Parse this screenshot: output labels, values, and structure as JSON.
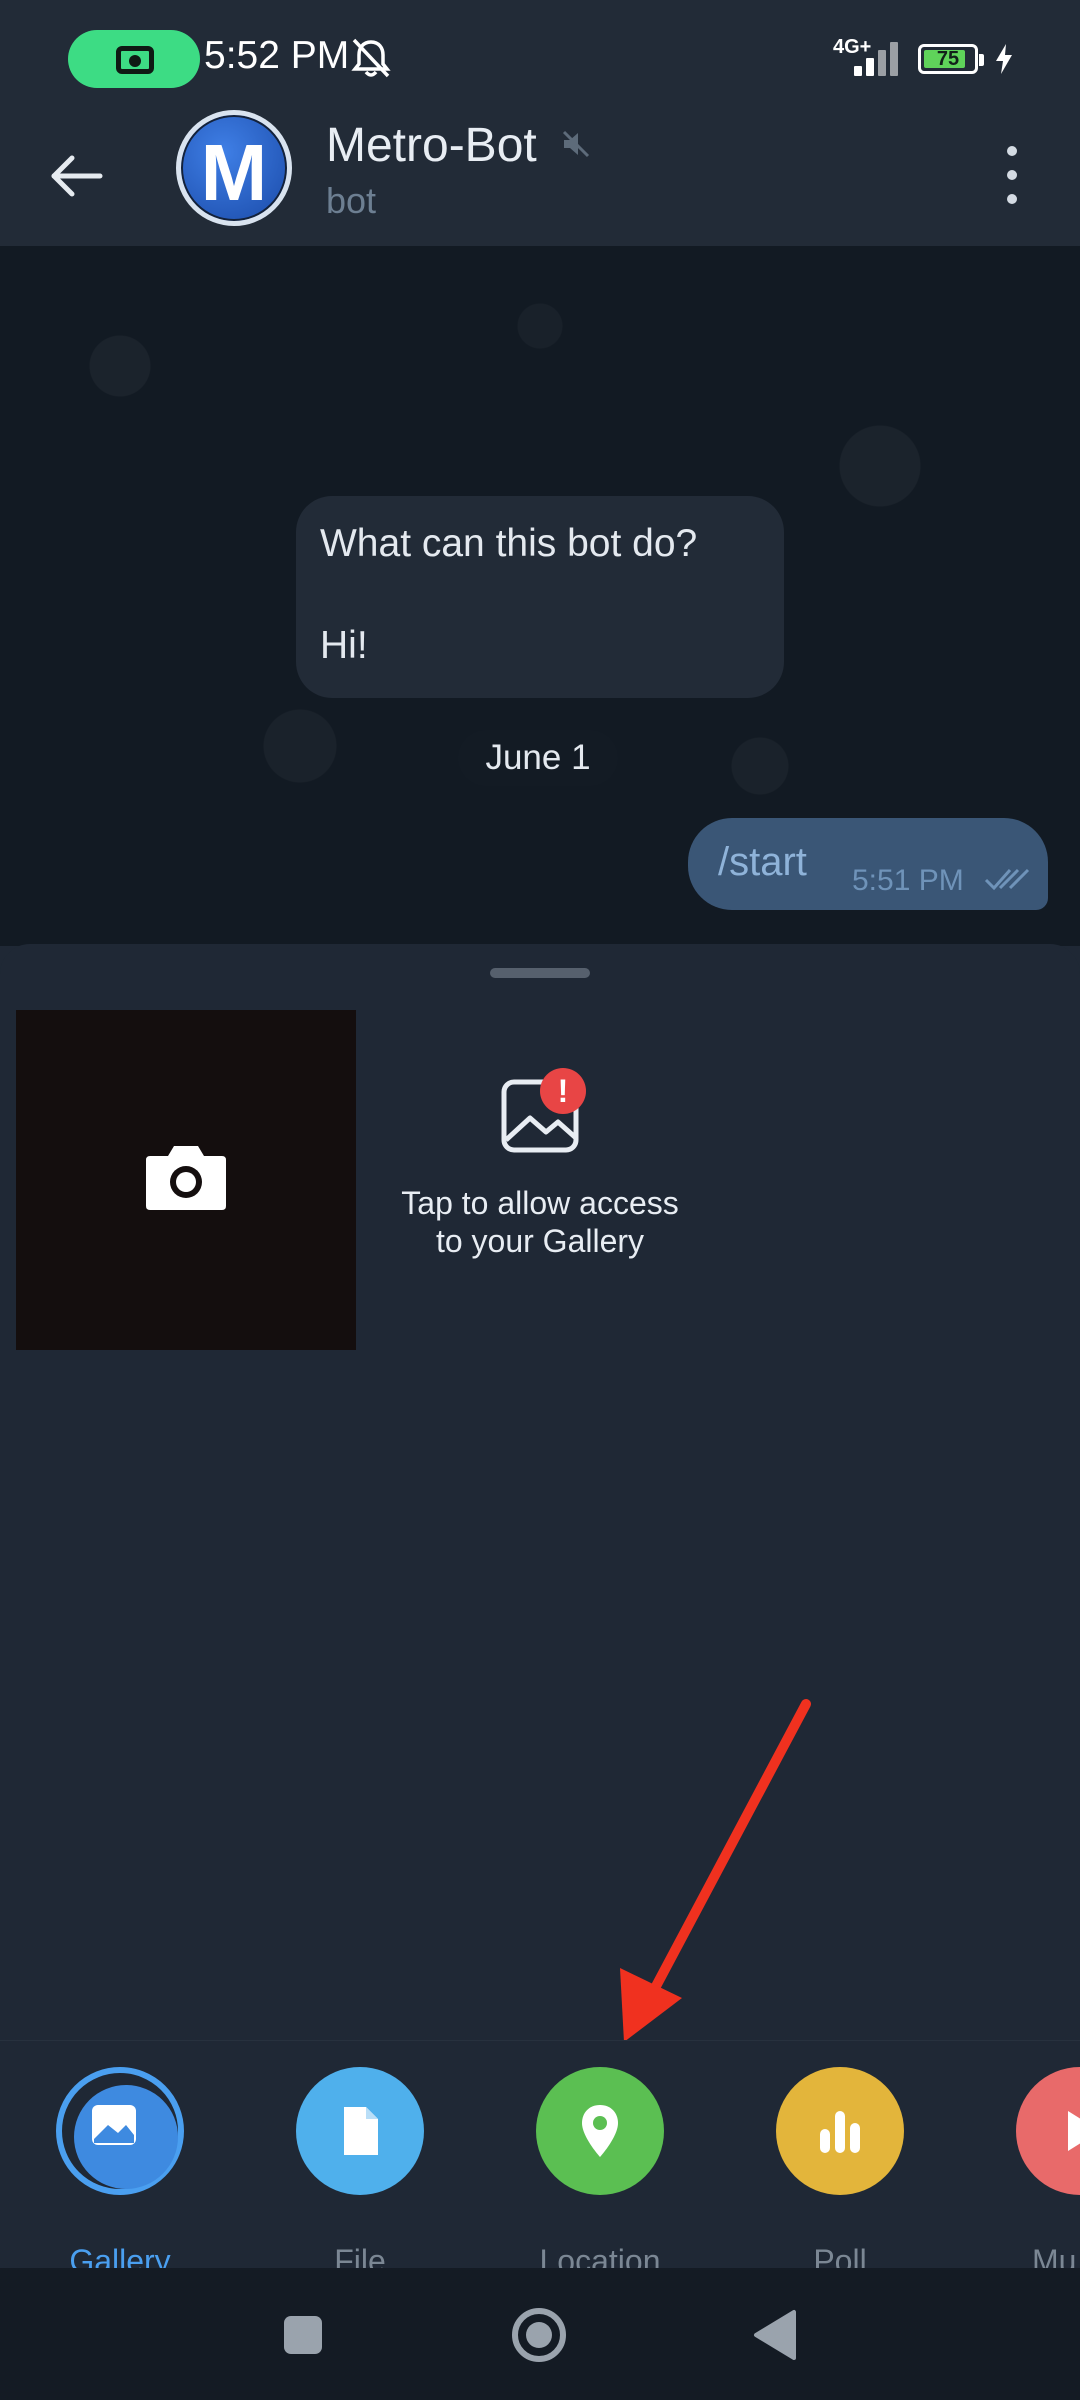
{
  "status_bar": {
    "time": "5:52 PM",
    "network": "4G+",
    "battery": "75"
  },
  "header": {
    "avatar_letter": "M",
    "title": "Metro-Bot",
    "subtitle": "bot"
  },
  "chat": {
    "bot_info_question": "What can this bot do?",
    "bot_info_answer": "Hi!",
    "date_separator": "June 1",
    "outgoing_message": {
      "text": "/start",
      "time": "5:51 PM"
    }
  },
  "attachment_sheet": {
    "gallery_permission_line1": "Tap to allow access",
    "gallery_permission_line2": "to your Gallery",
    "permission_badge": "!"
  },
  "attach_menu": {
    "items": [
      {
        "label": "Gallery",
        "color": "#4a9ff0"
      },
      {
        "label": "File",
        "color": "#4fb0ec"
      },
      {
        "label": "Location",
        "color": "#5bbf52"
      },
      {
        "label": "Poll",
        "color": "#e3b53b"
      },
      {
        "label": "Mu",
        "color": "#e86a6a"
      }
    ]
  },
  "colors": {
    "accent": "#4a9ff0",
    "annotation_arrow": "#f0311f"
  }
}
